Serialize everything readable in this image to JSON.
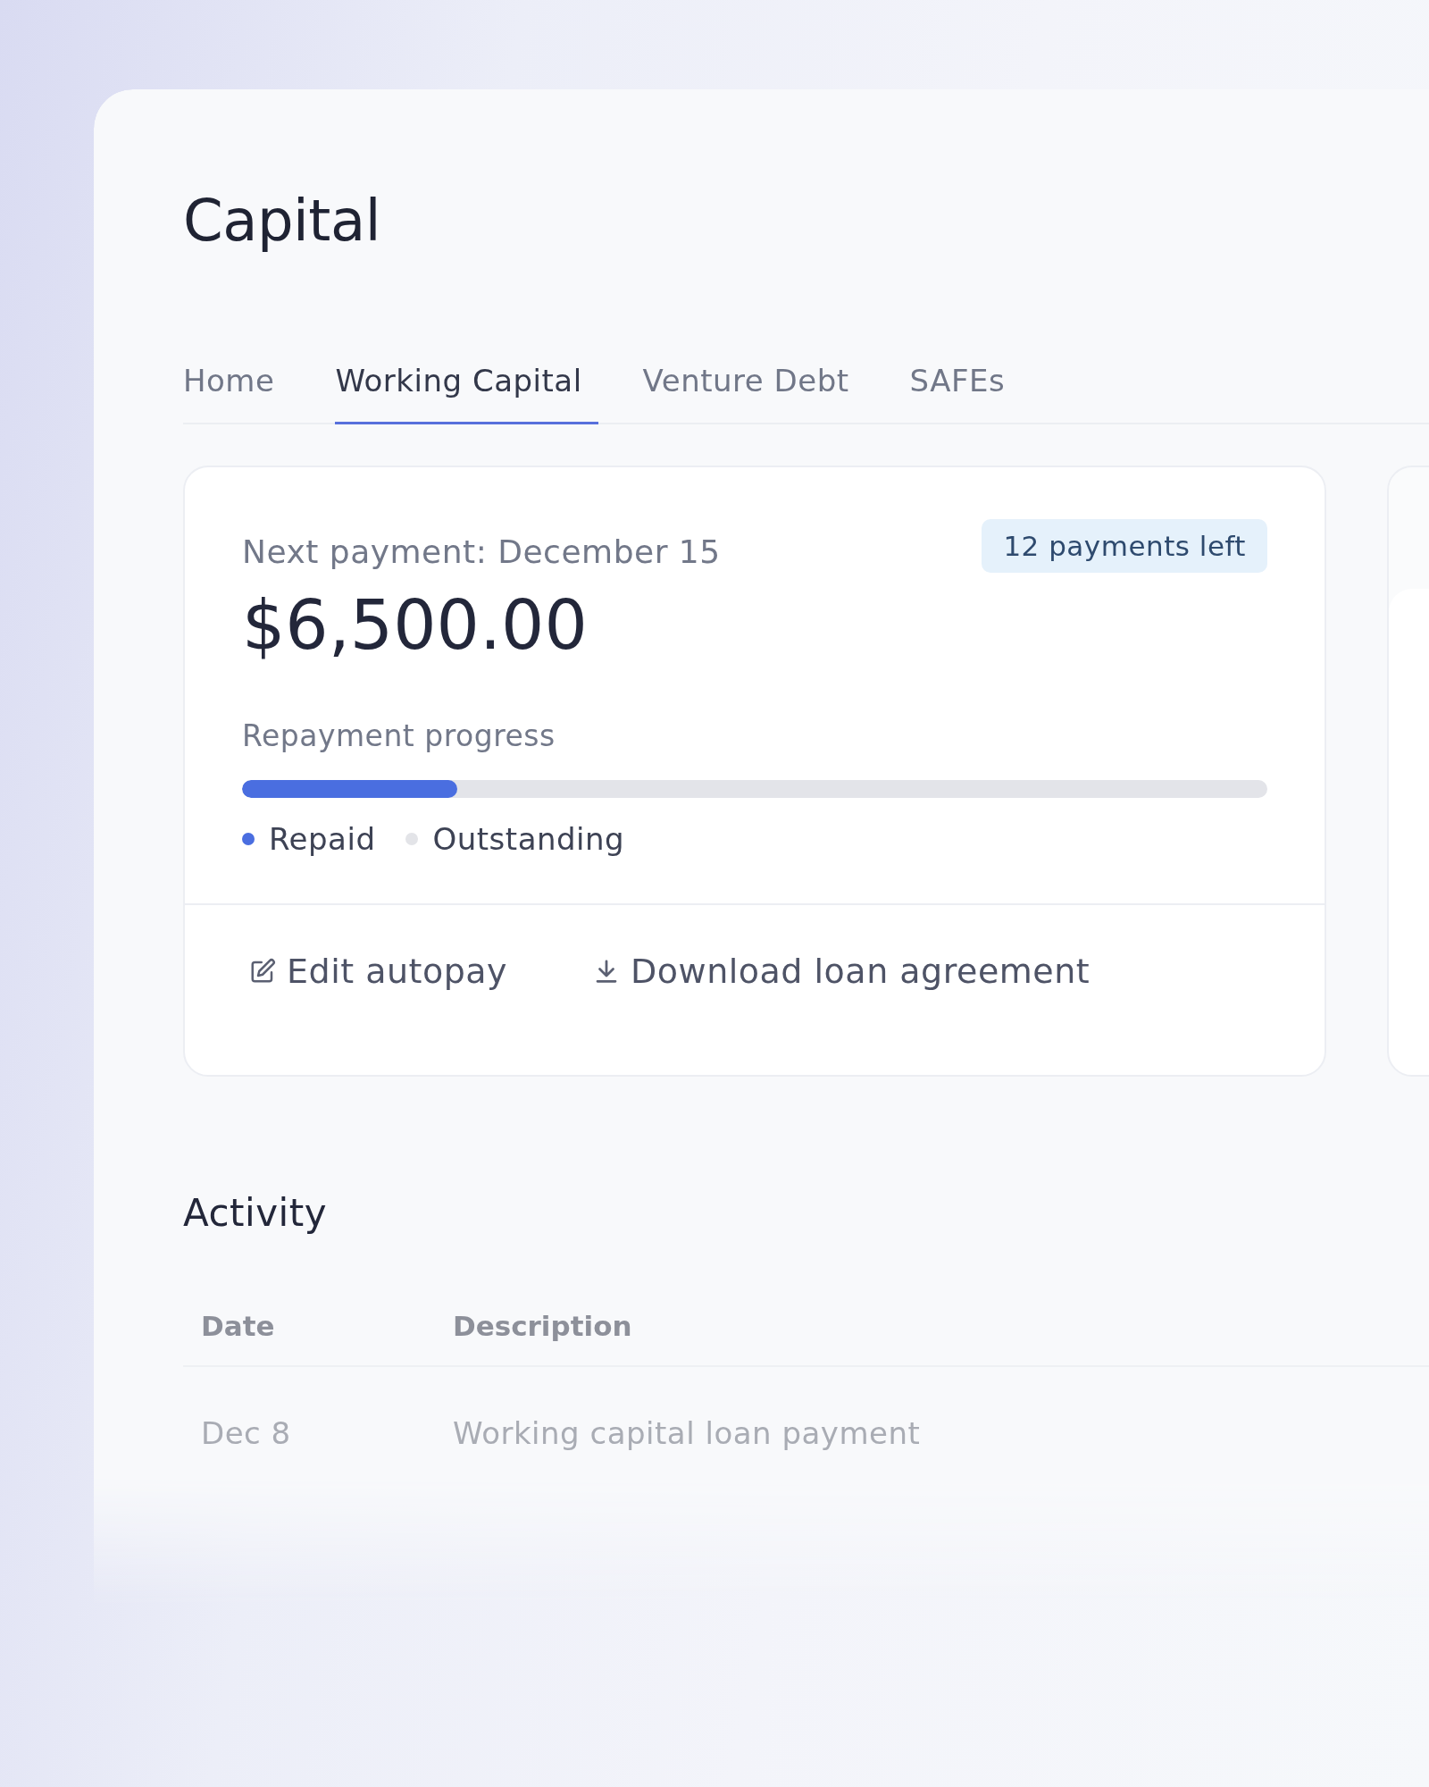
{
  "page": {
    "title": "Capital"
  },
  "tabs": [
    {
      "label": "Home",
      "selected": false
    },
    {
      "label": "Working Capital",
      "selected": true
    },
    {
      "label": "Venture Debt",
      "selected": false
    },
    {
      "label": "SAFEs",
      "selected": false
    }
  ],
  "payment_card": {
    "next_payment": "Next payment: December 15",
    "badge": "12 payments left",
    "amount": "$6,500.00",
    "progress_label": "Repayment progress",
    "level": 0.21,
    "legend": [
      {
        "label": "Repaid",
        "color": "#4a6ee0"
      },
      {
        "label": "Outstanding",
        "color": "#e3e4e8"
      }
    ],
    "actions": [
      {
        "label": "Edit autopay",
        "kind": "edit"
      },
      {
        "label": "Download loan agreement",
        "kind": "download"
      }
    ]
  },
  "activity": {
    "title": "Activity",
    "columns": [
      "Date",
      "Description"
    ],
    "rows": [
      [
        "Dec 8",
        "Working capital loan payment"
      ]
    ]
  }
}
